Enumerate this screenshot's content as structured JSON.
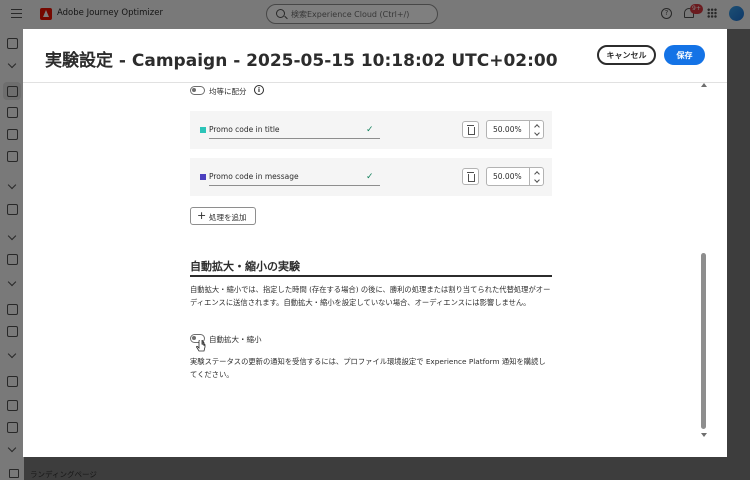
{
  "app": {
    "title": "Adobe Journey Optimizer",
    "search_placeholder": "検索Experience Cloud (Ctrl+/)",
    "notification_count": "9+",
    "bottom_nav_label": "ランディングページ"
  },
  "modal": {
    "title": "実験設定 - Campaign - 2025-05-15 10:18:02 UTC+02:00",
    "cancel_label": "キャンセル",
    "save_label": "保存"
  },
  "distribute_evenly": {
    "label": "均等に配分",
    "enabled": false,
    "info_icon": "i"
  },
  "treatments": [
    {
      "name": "Promo code in title",
      "percent": "50.00%",
      "color": "#2bc4b8"
    },
    {
      "name": "Promo code in message",
      "percent": "50.00%",
      "color": "#4b3fbf"
    }
  ],
  "add_treatment_label": "処理を追加",
  "auto_scaling": {
    "heading": "自動拡大・縮小の実験",
    "description": "自動拡大・縮小では、指定した時間 (存在する場合) の後に、勝利の処理または割り当てられた代替処理がオーディエンスに送信されます。自動拡大・縮小を設定していない場合、オーディエンスには影響しません。",
    "toggle_label": "自動拡大・縮小",
    "enabled": false,
    "notification_text": "実験ステータスの更新の通知を受信するには、プロファイル環境設定で Experience Platform 通知を購読してください。"
  },
  "colors": {
    "accent": "#1473e6",
    "check": "#12805c"
  }
}
